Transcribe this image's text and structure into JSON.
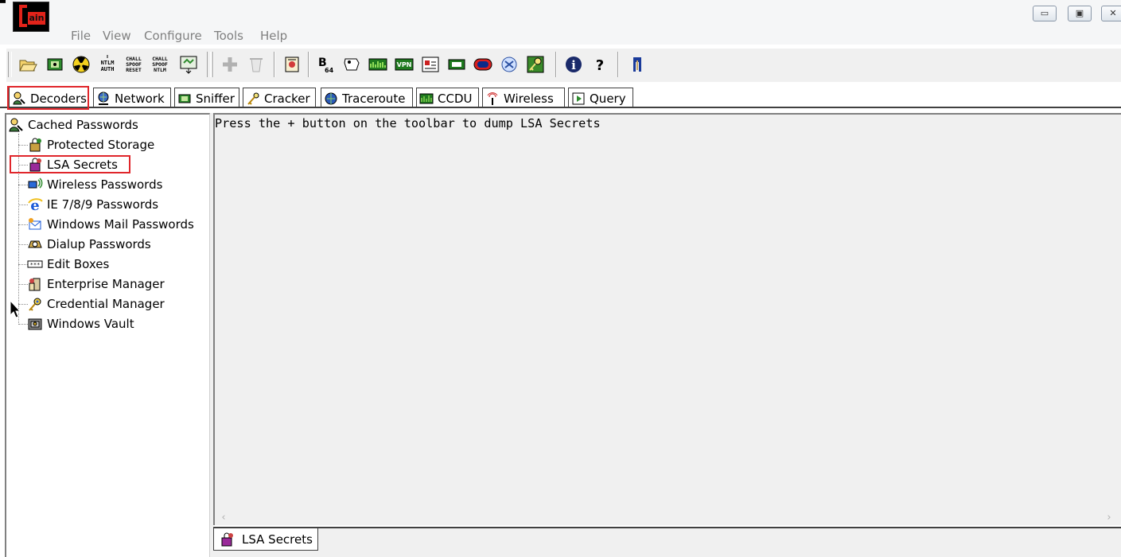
{
  "app": {
    "logo_text": "ain"
  },
  "window_controls": {
    "minimize": "▭",
    "restore": "▣",
    "close": "✕"
  },
  "menu": [
    "File",
    "View",
    "Configure",
    "Tools",
    "Help"
  ],
  "toolbar": {
    "buttons": [
      {
        "name": "open-icon",
        "enabled": true
      },
      {
        "name": "sniffer-start-icon",
        "enabled": true
      },
      {
        "name": "apr-icon",
        "enabled": true
      },
      {
        "name": "ntlm-auth-icon",
        "enabled": true,
        "label": "NTLM AUTH"
      },
      {
        "name": "chall-spoof-reset-icon",
        "enabled": true,
        "label": "CHALL SPOOF RESET"
      },
      {
        "name": "chall-spoof-ntlm-icon",
        "enabled": true,
        "label": "CHALL SPOOF NTLM"
      },
      {
        "name": "export-icon",
        "enabled": true
      },
      {
        "name": "add-icon",
        "enabled": false
      },
      {
        "name": "remove-icon",
        "enabled": false
      },
      {
        "name": "certificate-icon",
        "enabled": true
      },
      {
        "name": "base64-icon",
        "enabled": true,
        "label": "B64"
      },
      {
        "name": "hash-calculator-icon",
        "enabled": true
      },
      {
        "name": "network-monitor-icon",
        "enabled": true
      },
      {
        "name": "vpn-icon",
        "enabled": true,
        "label": "VPN"
      },
      {
        "name": "rdp-icon",
        "enabled": true
      },
      {
        "name": "card-icon",
        "enabled": true
      },
      {
        "name": "oracle-icon",
        "enabled": true
      },
      {
        "name": "cisco-icon",
        "enabled": true
      },
      {
        "name": "key-icon",
        "enabled": true
      },
      {
        "name": "info-icon",
        "enabled": true
      },
      {
        "name": "help-icon",
        "enabled": true
      },
      {
        "name": "exit-icon",
        "enabled": true
      }
    ]
  },
  "tabs": [
    {
      "label": "Decoders",
      "icon": "decoders-icon",
      "active": true
    },
    {
      "label": "Network",
      "icon": "network-icon"
    },
    {
      "label": "Sniffer",
      "icon": "sniffer-icon"
    },
    {
      "label": "Cracker",
      "icon": "cracker-icon"
    },
    {
      "label": "Traceroute",
      "icon": "traceroute-icon"
    },
    {
      "label": "CCDU",
      "icon": "ccdu-icon"
    },
    {
      "label": "Wireless",
      "icon": "wireless-icon"
    },
    {
      "label": "Query",
      "icon": "query-icon"
    }
  ],
  "tree": {
    "root": "Cached Passwords",
    "items": [
      {
        "label": "Protected Storage",
        "icon": "protected-storage-icon"
      },
      {
        "label": "LSA Secrets",
        "icon": "lsa-secrets-icon",
        "selected": true
      },
      {
        "label": "Wireless Passwords",
        "icon": "wireless-passwords-icon"
      },
      {
        "label": "IE 7/8/9 Passwords",
        "icon": "ie-icon"
      },
      {
        "label": "Windows Mail Passwords",
        "icon": "windows-mail-icon"
      },
      {
        "label": "Dialup Passwords",
        "icon": "dialup-icon"
      },
      {
        "label": "Edit Boxes",
        "icon": "edit-boxes-icon"
      },
      {
        "label": "Enterprise Manager",
        "icon": "enterprise-manager-icon"
      },
      {
        "label": "Credential Manager",
        "icon": "credential-manager-icon"
      },
      {
        "label": "Windows Vault",
        "icon": "windows-vault-icon"
      }
    ]
  },
  "content": {
    "message": "Press the + button on the toolbar to dump LSA Secrets"
  },
  "bottom_tab": {
    "label": "LSA Secrets",
    "icon": "lsa-secrets-icon"
  },
  "colors": {
    "highlight": "#e0262b",
    "logo_red": "#e2231a",
    "panel_bg": "#f0f0f0"
  }
}
